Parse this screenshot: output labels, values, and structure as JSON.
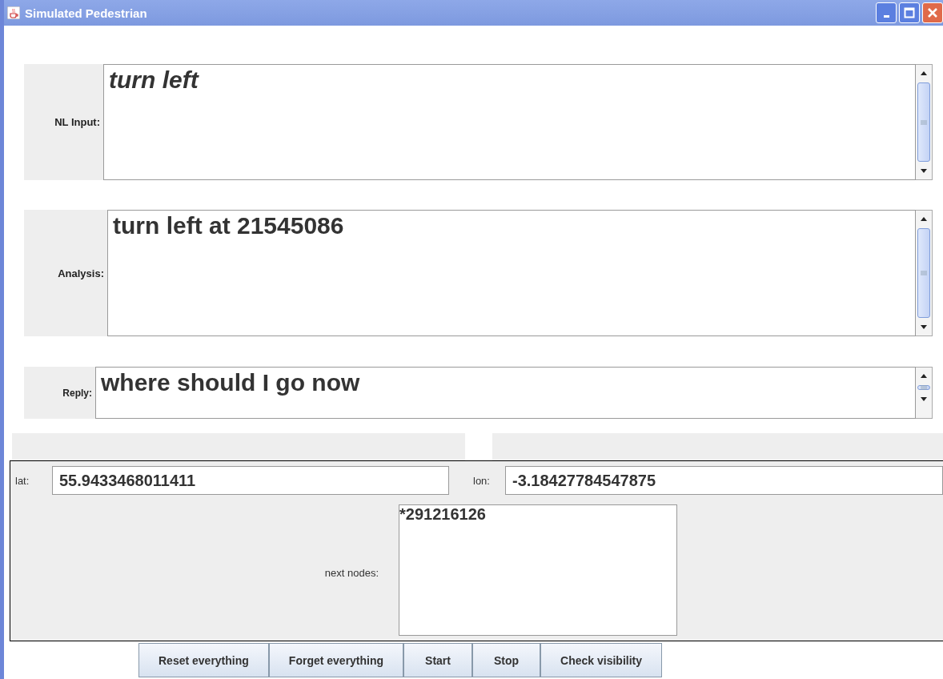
{
  "window": {
    "title": "Simulated Pedestrian"
  },
  "text_areas": [
    {
      "label": "NL Input:",
      "value": "turn left",
      "italic": true,
      "kind": "tall"
    },
    {
      "label": "Analysis:",
      "value": "turn left at 21545086",
      "italic": false,
      "kind": "tall"
    },
    {
      "label": "Reply:",
      "value": "where should I go now",
      "italic": false,
      "kind": "short"
    }
  ],
  "coordinates": {
    "lat_label": "lat:",
    "lat": "55.9433468011411",
    "lon_label": "lon:",
    "lon": "-3.18427784547875"
  },
  "next_nodes": {
    "label": "next nodes:",
    "items": [
      "*291216126"
    ]
  },
  "buttons": [
    "Reset everything",
    "Forget everything",
    "Start",
    "Stop",
    "Check visibility"
  ]
}
